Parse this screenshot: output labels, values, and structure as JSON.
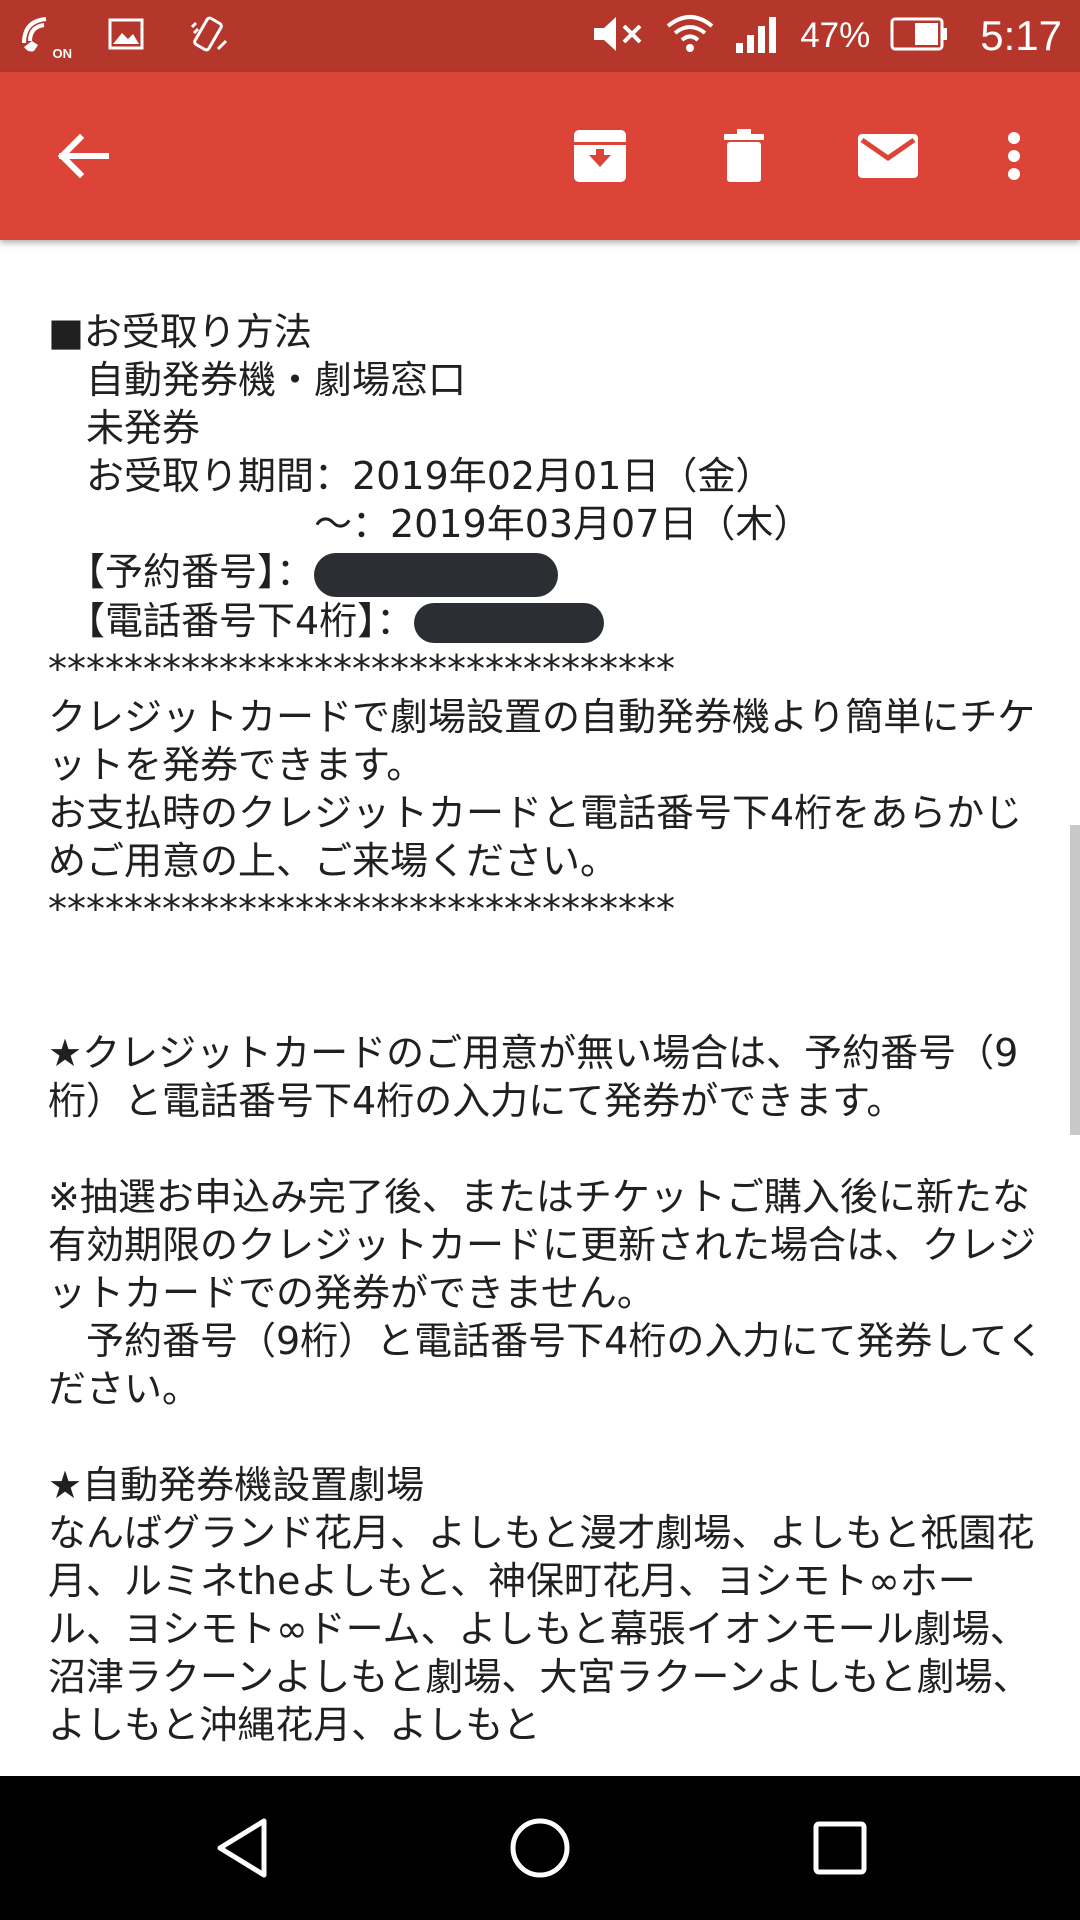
{
  "status_bar": {
    "left_icons": [
      "wifi-calling-icon",
      "image-icon",
      "vibrate-icon"
    ],
    "wifi_calling_label": "ON",
    "right_icons": [
      "mute-icon",
      "wifi-icon",
      "signal-icon",
      "battery-icon"
    ],
    "battery_percent": "47%",
    "time": "5:17",
    "colors": {
      "background": "#b5362b"
    }
  },
  "app_bar": {
    "icons": [
      "back-arrow-icon",
      "archive-icon",
      "delete-icon",
      "mark-unread-icon",
      "more-vert-icon"
    ],
    "colors": {
      "background": "#db4437"
    }
  },
  "email_body": {
    "section1": "■お受取り方法\n　自動発券機・劇場窓口\n　未発券\n　お受取り期間：2019年02月01日（金）\n　　　　　　　～：2019年03月07日（木）",
    "reservation_label": "　【予約番号】：",
    "phone_label": "　【電話番号下4桁】：",
    "section2": "\n*********************************\nクレジットカードで劇場設置の自動発券機より簡単にチケットを発券できます。\nお支払時のクレジットカードと電話番号下4桁をあらかじめご用意の上、ご来場ください。\n*********************************\n\n\n★クレジットカードのご用意が無い場合は、予約番号（9桁）と電話番号下4桁の入力にて発券ができます。\n\n※抽選お申込み完了後、またはチケットご購入後に新たな有効期限のクレジットカードに更新された場合は、クレジットカードでの発券ができません。\n　予約番号（9桁）と電話番号下4桁の入力にて発券してください。\n\n★自動発券機設置劇場\nなんばグランド花月、よしもと漫才劇場、よしもと祇園花月、ルミネtheよしもと、神保町花月、ヨシモト∞ホール、ヨシモト∞ドーム、よしもと幕張イオンモール劇場、沼津ラクーンよしもと劇場、大宮ラクーンよしもと劇場、よしもと沖縄花月、よしもと"
  },
  "nav_bar": {
    "icons": [
      "back-triangle-icon",
      "home-circle-icon",
      "recents-square-icon"
    ]
  }
}
